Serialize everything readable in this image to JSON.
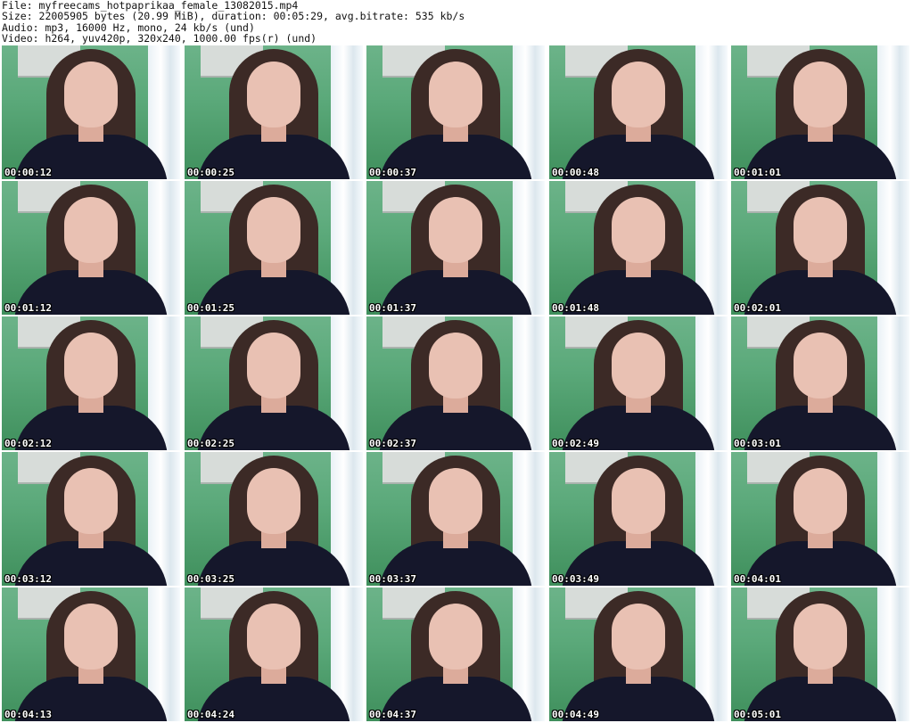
{
  "header": {
    "file_line": "File: myfreecams_hotpaprikaa_female_13082015.mp4",
    "size_line": "Size: 22005905 bytes (20.99 MiB), duration: 00:05:29, avg.bitrate: 535 kb/s",
    "audio_line": "Audio: mp3, 16000 Hz, mono, 24 kb/s (und)",
    "video_line": "Video: h264, yuv420p, 320x240, 1000.00 fps(r) (und)"
  },
  "thumbnails": [
    {
      "timestamp": "00:00:12"
    },
    {
      "timestamp": "00:00:25"
    },
    {
      "timestamp": "00:00:37"
    },
    {
      "timestamp": "00:00:48"
    },
    {
      "timestamp": "00:01:01"
    },
    {
      "timestamp": "00:01:12"
    },
    {
      "timestamp": "00:01:25"
    },
    {
      "timestamp": "00:01:37"
    },
    {
      "timestamp": "00:01:48"
    },
    {
      "timestamp": "00:02:01"
    },
    {
      "timestamp": "00:02:12"
    },
    {
      "timestamp": "00:02:25"
    },
    {
      "timestamp": "00:02:37"
    },
    {
      "timestamp": "00:02:49"
    },
    {
      "timestamp": "00:03:01"
    },
    {
      "timestamp": "00:03:12"
    },
    {
      "timestamp": "00:03:25"
    },
    {
      "timestamp": "00:03:37"
    },
    {
      "timestamp": "00:03:49"
    },
    {
      "timestamp": "00:04:01"
    },
    {
      "timestamp": "00:04:13"
    },
    {
      "timestamp": "00:04:24"
    },
    {
      "timestamp": "00:04:37"
    },
    {
      "timestamp": "00:04:49"
    },
    {
      "timestamp": "00:05:01"
    }
  ]
}
